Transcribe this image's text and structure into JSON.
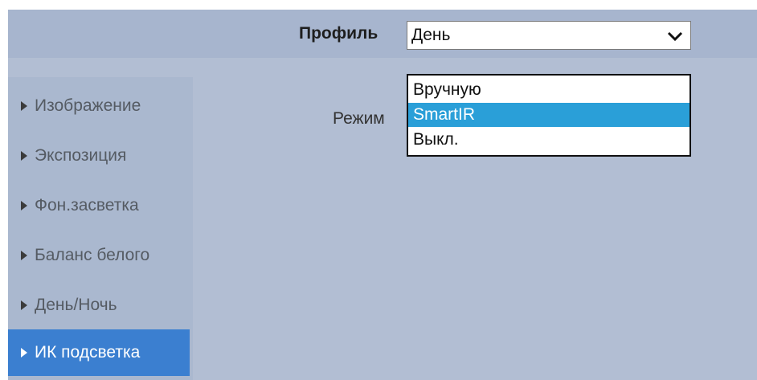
{
  "header": {
    "profile_label": "Профиль",
    "profile_value": "День"
  },
  "sidebar": {
    "items": [
      {
        "label": "Изображение",
        "active": false
      },
      {
        "label": "Экспозиция",
        "active": false
      },
      {
        "label": "Фон.засветка",
        "active": false
      },
      {
        "label": "Баланс белого",
        "active": false
      },
      {
        "label": "День/Ночь",
        "active": false
      },
      {
        "label": "ИК подсветка",
        "active": true
      }
    ]
  },
  "main": {
    "mode_label": "Режим",
    "mode_options": [
      "Вручную",
      "SmartIR",
      "Выкл."
    ],
    "mode_highlighted": "SmartIR"
  },
  "colors": {
    "header_bg": "#a7b5ce",
    "panel_bg": "#b2bed3",
    "active_item": "#3b7fd0",
    "highlight": "#2a9fd8"
  },
  "icons": {
    "select_arrow": "chevron-down-icon",
    "nav_bullet": "triangle-right-icon"
  }
}
